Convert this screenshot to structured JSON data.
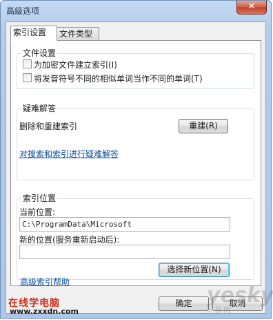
{
  "window": {
    "title": "高级选项",
    "close_glyph": "✕"
  },
  "tabs": [
    {
      "label": "索引设置"
    },
    {
      "label": "文件类型"
    }
  ],
  "file_settings": {
    "title": "文件设置",
    "checkbox1_label": "为加密文件建立索引(I)",
    "checkbox1_checked": false,
    "checkbox2_label": "将发音符号不同的相似单词当作不同的单词(T)",
    "checkbox2_checked": false
  },
  "troubleshooting": {
    "title": "疑难解答",
    "rebuild_text": "删除和重建索引",
    "rebuild_button": "重建(R)",
    "link": "对搜索和索引进行疑难解答"
  },
  "index_location": {
    "title": "索引位置",
    "current_label": "当前位置:",
    "current_value": "C:\\ProgramData\\Microsoft",
    "new_label": "新的位置(服务重新启动后):",
    "new_value": "",
    "select_button": "选择新位置(N)"
  },
  "help_link": "高级索引帮助",
  "buttons": {
    "ok": "确定",
    "cancel": "取消"
  },
  "watermark": {
    "site_name": "在线学电脑",
    "site_url": "www.zxxdn.com",
    "yesky": "yesky",
    "yesky_sub": "天极网"
  }
}
